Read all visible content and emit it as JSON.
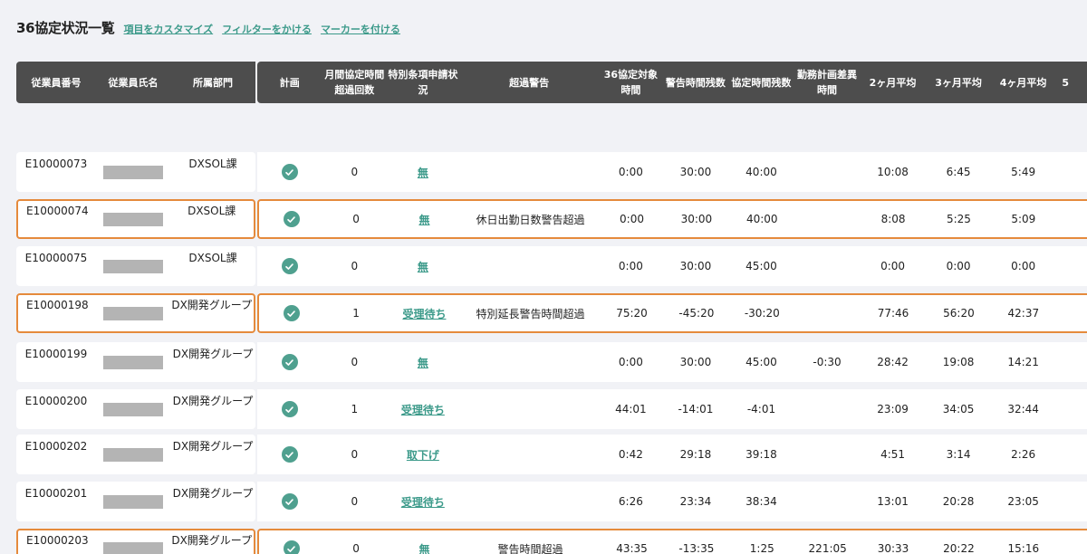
{
  "header": {
    "title": "36協定状況一覧",
    "links": [
      "項目をカスタマイズ",
      "フィルターをかける",
      "マーカーを付ける"
    ]
  },
  "left_columns": [
    "従業員番号",
    "従業員氏名",
    "所属部門"
  ],
  "right_columns": [
    "計画",
    "月間協定時間超過回数",
    "特別条項申請状況",
    "超過警告",
    "36協定対象時間",
    "警告時間残数",
    "協定時間残数",
    "勤務計画差異時間",
    "2ヶ月平均",
    "3ヶ月平均",
    "4ヶ月平均",
    "5"
  ],
  "rows": [
    {
      "emp_id": "E10000073",
      "dept": "DXSOL課",
      "count": "0",
      "app": "無",
      "warning": "",
      "t36": "0:00",
      "warn_rem": "30:00",
      "agr_rem": "40:00",
      "diff": "",
      "avg2": "10:08",
      "avg3": "6:45",
      "avg4": "5:49",
      "highlight": false
    },
    {
      "emp_id": "E10000074",
      "dept": "DXSOL課",
      "count": "0",
      "app": "無",
      "warning": "休日出勤日数警告超過",
      "t36": "0:00",
      "warn_rem": "30:00",
      "agr_rem": "40:00",
      "diff": "",
      "avg2": "8:08",
      "avg3": "5:25",
      "avg4": "5:09",
      "highlight": true
    },
    {
      "emp_id": "E10000075",
      "dept": "DXSOL課",
      "count": "0",
      "app": "無",
      "warning": "",
      "t36": "0:00",
      "warn_rem": "30:00",
      "agr_rem": "45:00",
      "diff": "",
      "avg2": "0:00",
      "avg3": "0:00",
      "avg4": "0:00",
      "highlight": false
    },
    {
      "emp_id": "E10000198",
      "dept": "DX開発グループ",
      "count": "1",
      "app": "受理待ち",
      "warning": "特別延長警告時間超過",
      "t36": "75:20",
      "warn_rem": "-45:20",
      "agr_rem": "-30:20",
      "diff": "",
      "avg2": "77:46",
      "avg3": "56:20",
      "avg4": "42:37",
      "highlight": true
    },
    {
      "emp_id": "E10000199",
      "dept": "DX開発グループ",
      "count": "0",
      "app": "無",
      "warning": "",
      "t36": "0:00",
      "warn_rem": "30:00",
      "agr_rem": "45:00",
      "diff": "-0:30",
      "avg2": "28:42",
      "avg3": "19:08",
      "avg4": "14:21",
      "highlight": false
    },
    {
      "emp_id": "E10000200",
      "dept": "DX開発グループ",
      "count": "1",
      "app": "受理待ち",
      "warning": "",
      "t36": "44:01",
      "warn_rem": "-14:01",
      "agr_rem": "-4:01",
      "diff": "",
      "avg2": "23:09",
      "avg3": "34:05",
      "avg4": "32:44",
      "highlight": false
    },
    {
      "emp_id": "E10000202",
      "dept": "DX開発グループ",
      "count": "0",
      "app": "取下げ",
      "warning": "",
      "t36": "0:42",
      "warn_rem": "29:18",
      "agr_rem": "39:18",
      "diff": "",
      "avg2": "4:51",
      "avg3": "3:14",
      "avg4": "2:26",
      "highlight": false
    },
    {
      "emp_id": "E10000201",
      "dept": "DX開発グループ",
      "count": "0",
      "app": "受理待ち",
      "warning": "",
      "t36": "6:26",
      "warn_rem": "23:34",
      "agr_rem": "38:34",
      "diff": "",
      "avg2": "13:01",
      "avg3": "20:28",
      "avg4": "23:05",
      "highlight": false
    },
    {
      "emp_id": "E10000203",
      "dept": "DX開発グループ",
      "count": "0",
      "app": "無",
      "warning": "警告時間超過",
      "t36": "43:35",
      "warn_rem": "-13:35",
      "agr_rem": "1:25",
      "diff": "221:05",
      "avg2": "30:33",
      "avg3": "20:22",
      "avg4": "15:16",
      "highlight": true
    }
  ],
  "colors": {
    "accent": "#3c9a8a",
    "header_bg": "#4d4d4d",
    "highlight": "#e58a3c"
  }
}
